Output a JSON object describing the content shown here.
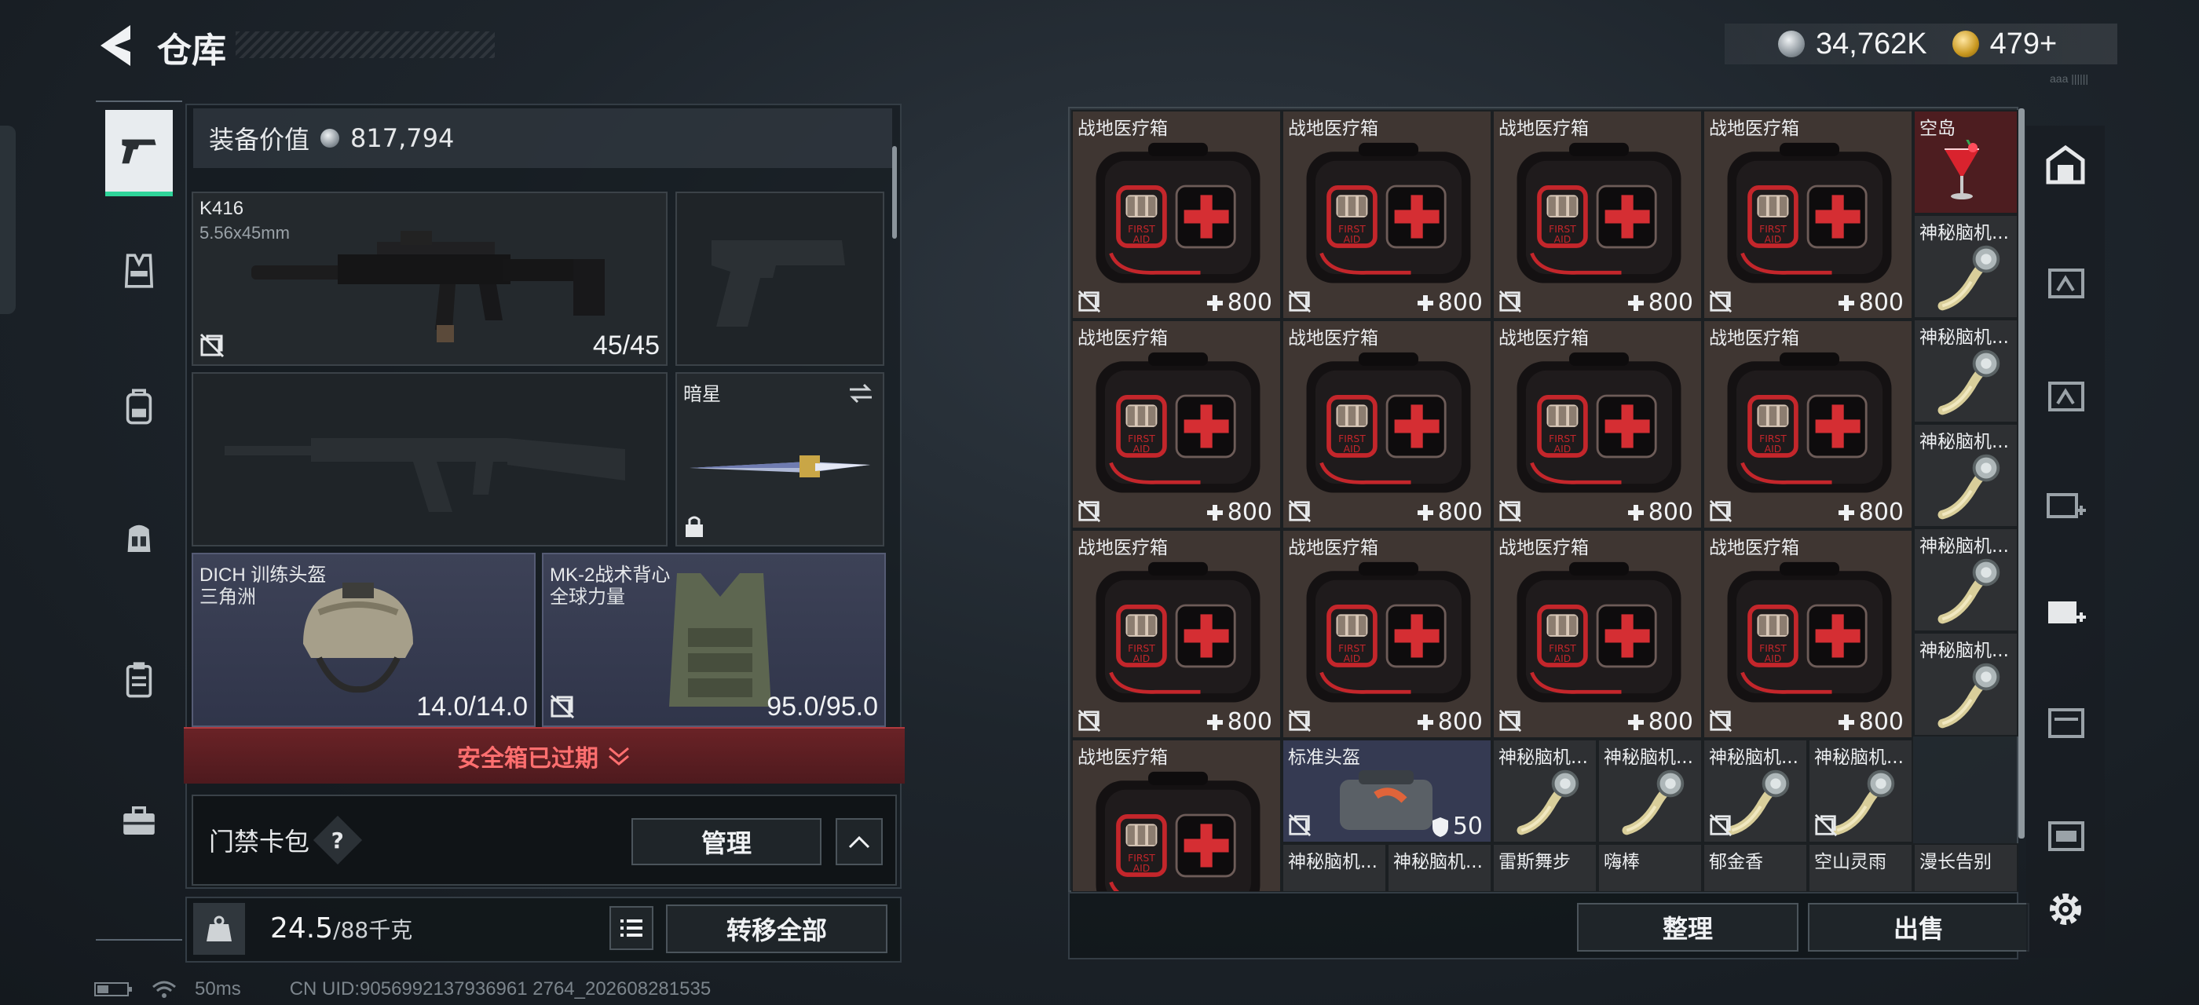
{
  "header": {
    "title": "仓库"
  },
  "currency": [
    {
      "icon": "silver-coin-icon",
      "value": "34,762K"
    },
    {
      "icon": "gold-coin-icon",
      "value": "479+"
    }
  ],
  "build": "ааа ||||||",
  "left_nav": [
    {
      "name": "nav-weapons",
      "icon": "pistol-icon",
      "active": true
    },
    {
      "name": "nav-armor",
      "icon": "vest-icon",
      "active": false
    },
    {
      "name": "nav-backpack",
      "icon": "backpack-icon",
      "active": false
    },
    {
      "name": "nav-chest-rig",
      "icon": "rig-icon",
      "active": false
    },
    {
      "name": "nav-pouch",
      "icon": "pouch-icon",
      "active": false
    },
    {
      "name": "nav-case",
      "icon": "briefcase-icon",
      "active": false
    }
  ],
  "equipment": {
    "value_label": "装备价值",
    "value": "817,794",
    "primary": {
      "name": "K416",
      "caliber": "5.56x45mm",
      "ammo": "45/45"
    },
    "melee": {
      "name": "暗星"
    },
    "helmet": {
      "name": "DICH 训练头盔",
      "maker": "三角洲",
      "durability": "14.0/14.0"
    },
    "armor": {
      "name": "MK-2战术背心",
      "maker": "全球力量",
      "durability": "95.0/95.0"
    }
  },
  "safe_box": {
    "label": "安全箱已过期"
  },
  "keycard": {
    "label": "门禁卡包",
    "help": "?",
    "manage": "管理"
  },
  "weight": {
    "current": "24.5",
    "max": "/88千克"
  },
  "transfer_all": "转移全部",
  "status": {
    "ping": "50ms",
    "uid": "CN UID:9056992137936961 2764_202608281535"
  },
  "inventory": {
    "medkit_name": "战地医疗箱",
    "medkit_value": "800",
    "neural_name": "神秘脑机...",
    "drink_name": "空岛",
    "helmet_bag_name": "标准头盔",
    "helmet_bag_value": "50",
    "bottom_row": [
      "神秘脑机...",
      "神秘脑机...",
      "雷斯舞步",
      "嗨棒",
      "郁金香",
      "空山灵雨",
      "漫长告别"
    ]
  },
  "actions": {
    "sort": "整理",
    "sell": "出售"
  },
  "right_nav": [
    {
      "name": "rnav-all",
      "icon": "vault-icon"
    },
    {
      "name": "rnav-1",
      "icon": "storage-tier-icon"
    },
    {
      "name": "rnav-2",
      "icon": "storage-tier-icon"
    },
    {
      "name": "rnav-3",
      "icon": "storage-add-icon"
    },
    {
      "name": "rnav-4",
      "icon": "storage-add-icon"
    },
    {
      "name": "rnav-5",
      "icon": "storage-tier-icon"
    },
    {
      "name": "rnav-6",
      "icon": "storage-tier-icon"
    },
    {
      "name": "rnav-settings",
      "icon": "gear-icon"
    }
  ]
}
